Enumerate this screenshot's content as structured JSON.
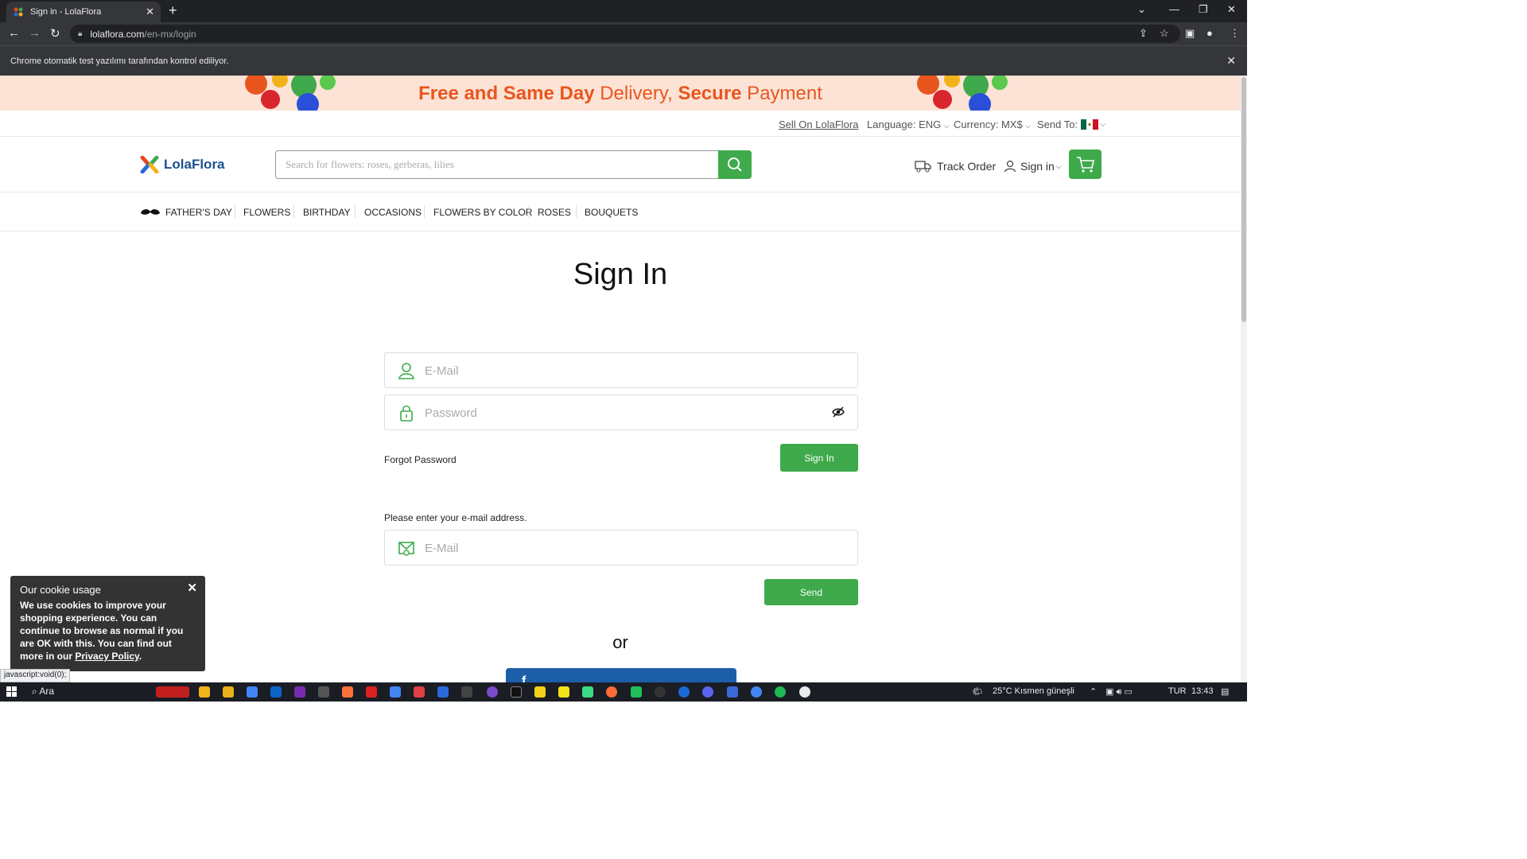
{
  "browser": {
    "tab_title": "Sign in - LolaFlora",
    "tab_close": "✕",
    "new_tab": "+",
    "url_host": "lolaflora.com",
    "url_path": "/en-mx/login",
    "infobar_text": "Chrome otomatik test yazılımı tarafından kontrol ediliyor.",
    "infobar_close": "✕"
  },
  "banner": {
    "part1": "Free and ",
    "part2": "Same Day",
    "part3": " Delivery, ",
    "part4": "Secure",
    "part5": " Payment",
    "colors": {
      "accent": "#e8561e",
      "bg": "#fde3d6"
    }
  },
  "topbar": {
    "sell": "Sell On LolaFlora",
    "language": "Language: ENG",
    "currency": "Currency: MX$",
    "send_to": "Send To:"
  },
  "header": {
    "logo_text": "LolaFlora",
    "search_placeholder": "Search for flowers: roses, gerberas, lilies",
    "track_order": "Track Order",
    "sign_in": "Sign in"
  },
  "menu": {
    "items": [
      "FATHER'S DAY",
      "FLOWERS",
      "BIRTHDAY",
      "OCCASIONS",
      "FLOWERS BY COLOR",
      "ROSES",
      "BOUQUETS"
    ]
  },
  "login": {
    "title": "Sign In",
    "email_placeholder": "E-Mail",
    "password_placeholder": "Password",
    "forgot": "Forgot Password",
    "signin_button": "Sign In",
    "hint": "Please enter your e-mail address.",
    "reset_email_placeholder": "E-Mail",
    "send_button": "Send",
    "or": "or",
    "facebook_glyph": "f"
  },
  "cookie": {
    "title": "Our cookie usage",
    "body": "We use cookies to improve your shopping experience. You can continue to browse as normal if you are OK with this. You can find out more in our ",
    "link": "Privacy Policy",
    "end": ".",
    "close": "✕"
  },
  "status_bar": "javascript:void(0);",
  "taskbar": {
    "search": "Ara",
    "weather": "25°C  Kısmen güneşli",
    "lang": "TUR",
    "time": "13:43"
  },
  "colors": {
    "brand_green": "#3eaa4b",
    "brand_blue": "#1d4f91",
    "facebook": "#1d5ea8"
  }
}
